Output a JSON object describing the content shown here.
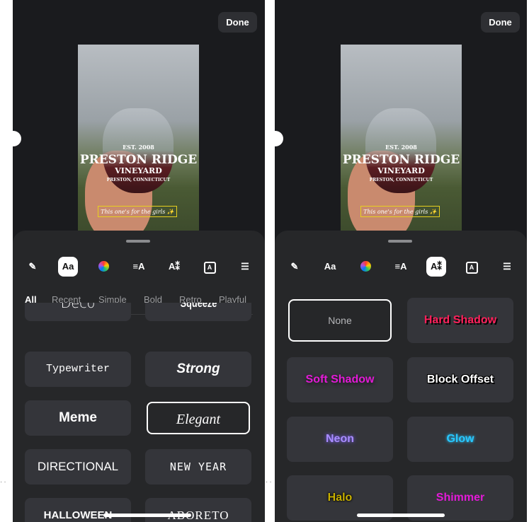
{
  "done_label": "Done",
  "photo": {
    "glass_est": "EST.",
    "glass_year": "2008",
    "glass_line1": "PRESTON RIDGE",
    "glass_line2": "VINEYARD",
    "glass_line3": "PRESTON, CONNECTICUT",
    "caption": "This one's for the girls ✨"
  },
  "toolbar_icons": [
    "pencil-icon",
    "font-icon",
    "color-icon",
    "align-icon",
    "effects-icon",
    "background-icon",
    "menu-icon"
  ],
  "tool_labels": {
    "font": "Aa",
    "align": "≡A",
    "effects": "A⁑",
    "background": "A"
  },
  "left": {
    "categories": [
      "All",
      "Recent",
      "Simple",
      "Bold",
      "Retro",
      "Playful"
    ],
    "fonts": [
      "Deco",
      "Squeeze",
      "Typewriter",
      "Strong",
      "Meme",
      "Elegant",
      "DIRECTIONAL",
      "NEW YEAR",
      "HALLOWEEN",
      "ABORETO"
    ]
  },
  "right": {
    "effects": [
      "None",
      "Hard Shadow",
      "Soft Shadow",
      "Block Offset",
      "Neon",
      "Glow",
      "Halo",
      "Shimmer"
    ]
  },
  "colors": {
    "hard_shadow": "#ff1f5a",
    "soft_shadow": "#e21ad6",
    "neon": "#a98cff",
    "glow": "#28c8ff",
    "halo": "#c8b000",
    "shimmer": "#e21ad6"
  }
}
